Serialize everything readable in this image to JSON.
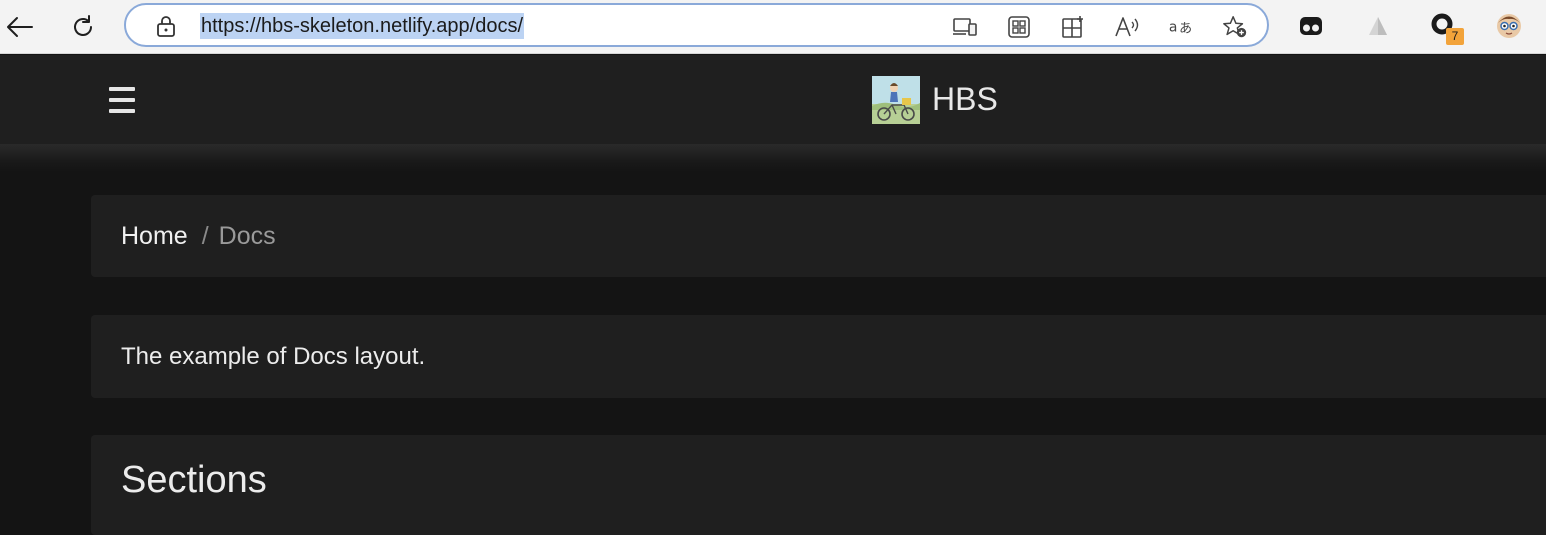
{
  "browser": {
    "url": "https://hbs-skeleton.netlify.app/docs/",
    "nav_icons": [
      "back-arrow-icon",
      "refresh-icon"
    ],
    "omnibox_icons": [
      "lock-icon",
      "app-available-icon",
      "qr-code-icon",
      "split-screen-icon",
      "read-aloud-icon",
      "translate-icon",
      "add-favorite-icon"
    ],
    "extension_icons": [
      "extension-mask-icon",
      "extension-triangle-icon",
      "extension-ring-icon",
      "profile-avatar-icon"
    ],
    "extension_badge": "7",
    "accent_color": "#8aa9d9",
    "badge_color": "#f2a33a"
  },
  "header": {
    "site_title": "HBS",
    "menu_icon": "hamburger-menu-icon",
    "logo": "site-logo-bicycle-illustration"
  },
  "breadcrumb": {
    "items": [
      {
        "label": "Home",
        "active": false
      },
      {
        "label": "Docs",
        "active": true
      }
    ],
    "separator": "/"
  },
  "main": {
    "description": "The example of Docs layout.",
    "sections_heading": "Sections"
  },
  "theme": {
    "background": "#141414",
    "surface": "#1f1f1f",
    "text": "#ececec",
    "muted_text": "#9a9a9a"
  }
}
